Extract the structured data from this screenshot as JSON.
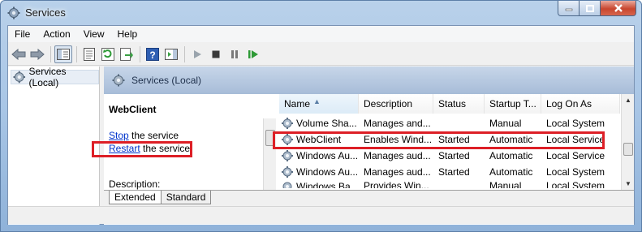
{
  "window": {
    "title": "Services"
  },
  "menu": [
    "File",
    "Action",
    "View",
    "Help"
  ],
  "toolbar": [
    {
      "name": "back-icon"
    },
    {
      "name": "forward-icon"
    },
    {
      "name": "show-hide-console-tree-icon"
    },
    {
      "name": "properties-icon"
    },
    {
      "name": "refresh-icon"
    },
    {
      "name": "export-list-icon"
    },
    {
      "name": "help-icon"
    },
    {
      "name": "show-hide-action-pane-icon"
    },
    {
      "name": "start-service-icon"
    },
    {
      "name": "stop-service-icon"
    },
    {
      "name": "pause-service-icon"
    },
    {
      "name": "restart-service-icon"
    }
  ],
  "tree": {
    "label": "Services (Local)"
  },
  "pane": {
    "header": "Services (Local)"
  },
  "extended": {
    "service_name": "WebClient",
    "stop_link": "Stop",
    "stop_rest": " the service",
    "restart_link": "Restart",
    "restart_rest": " the service",
    "description_label": "Description:"
  },
  "table": {
    "columns": [
      "Name",
      "Description",
      "Status",
      "Startup T...",
      "Log On As"
    ],
    "rows": [
      [
        "Volume Sha...",
        "Manages and...",
        "",
        "Manual",
        "Local System"
      ],
      [
        "WebClient",
        "Enables Wind...",
        "Started",
        "Automatic",
        "Local Service"
      ],
      [
        "Windows Au...",
        "Manages aud...",
        "Started",
        "Automatic",
        "Local Service"
      ],
      [
        "Windows Au...",
        "Manages aud...",
        "Started",
        "Automatic",
        "Local System"
      ],
      [
        "Windows Ba...",
        "Provides Win...",
        "",
        "Manual",
        "Local System"
      ]
    ]
  },
  "tabs": [
    "Extended",
    "Standard"
  ],
  "colors": {
    "highlight": "#dd1f26",
    "link": "#0033cc"
  }
}
